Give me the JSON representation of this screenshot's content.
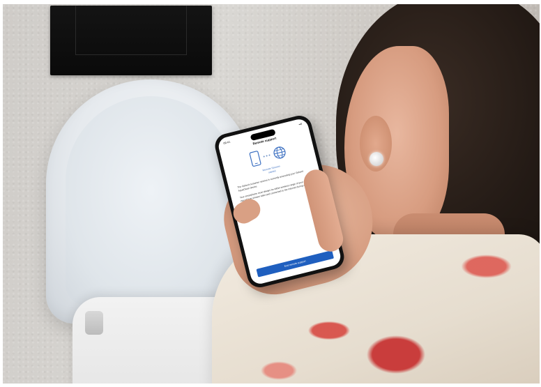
{
  "photo": {
    "description_colors": {
      "wall": "#d6d3cf",
      "flush_plate": "#111111",
      "toilet": "#eef1f4",
      "hair": "#231a15",
      "accent_shirt": "#c62c2c"
    }
  },
  "phone_screen": {
    "status_time": "09:41",
    "status_signal": "••ll",
    "title": "Remote support",
    "connection_status_line1": "Remote Session",
    "connection_status_line2": "started",
    "body_paragraph_1": "The Geberit customer service is currently accessing your Geberit AquaClean device.",
    "body_paragraph_2": "Your smartphone must always be within wireless range of your Geberit AquaClean shower toilet and connected to the Internet during access.",
    "primary_button_label": "End remote support",
    "icons": {
      "device": "smartphone-icon",
      "network": "globe-icon"
    },
    "accent_color": "#1f5fbf"
  }
}
